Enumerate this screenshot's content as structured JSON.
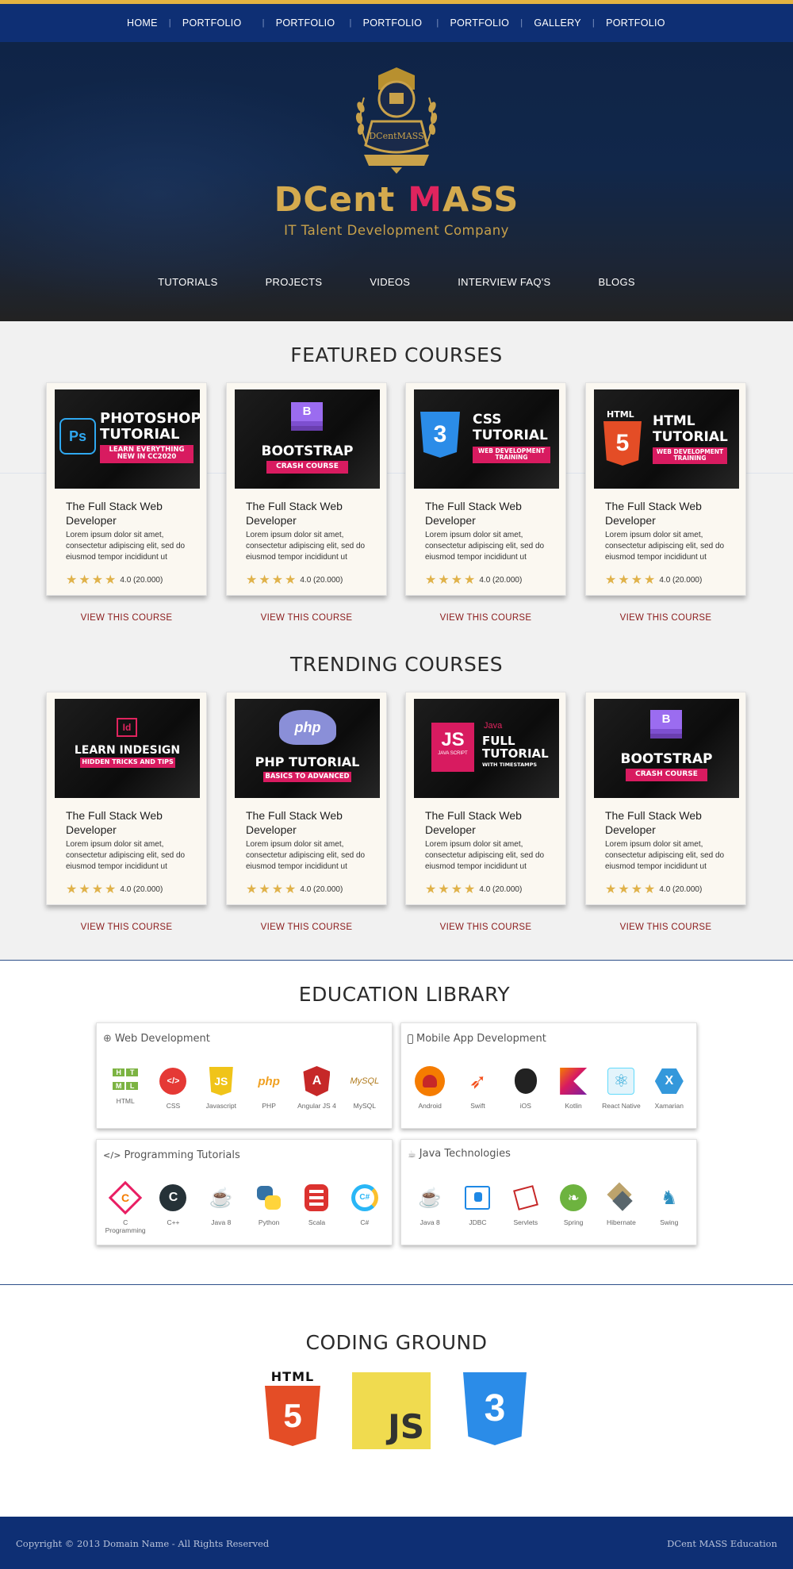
{
  "top_nav": {
    "items": [
      "HOME",
      "PORTFOLIO",
      "PORTFOLIO",
      "PORTFOLIO",
      "PORTFOLIO",
      "GALLERY",
      "PORTFOLIO"
    ]
  },
  "hero": {
    "emblem_text": "DCentMASS",
    "brand_main": "DCent ",
    "brand_accent": "M",
    "brand_rest": "ASS",
    "tagline": "IT Talent Development Company",
    "nav": [
      "TUTORIALS",
      "PROJECTS",
      "VIDEOS",
      "INTERVIEW FAQ'S",
      "BLOGS"
    ]
  },
  "featured": {
    "title": "FEATURED COURSES",
    "cards": [
      {
        "thumb": {
          "line1": "PHOTOSHOP",
          "line2": "TUTORIAL",
          "badge": "LEARN EVERYTHING NEW IN CC2020",
          "icon": "Ps"
        },
        "title": "The Full Stack Web Developer",
        "desc": "Lorem ipsum dolor sit amet, consectetur adipiscing elit, sed do eiusmod tempor incididunt ut",
        "rating": "4.0 (20.000)",
        "stars": 4,
        "link": "VIEW THIS COURSE"
      },
      {
        "thumb": {
          "line1": "BOOTSTRAP",
          "badge": "CRASH COURSE",
          "icon": "B"
        },
        "title": "The Full Stack Web Developer",
        "desc": "Lorem ipsum dolor sit amet, consectetur adipiscing elit, sed do eiusmod tempor incididunt ut",
        "rating": "4.0 (20.000)",
        "stars": 4,
        "link": "VIEW THIS COURSE"
      },
      {
        "thumb": {
          "line1": "CSS",
          "line2": "TUTORIAL",
          "badge": "WEB DEVELOPMENT TRAINING",
          "icon": "3"
        },
        "title": "The Full Stack Web Developer",
        "desc": "Lorem ipsum dolor sit amet, consectetur adipiscing elit, sed do eiusmod tempor incididunt ut",
        "rating": "4.0 (20.000)",
        "stars": 4,
        "link": "VIEW THIS COURSE"
      },
      {
        "thumb": {
          "line1": "HTML",
          "line2": "TUTORIAL",
          "badge": "WEB DEVELOPMENT TRAINING",
          "icon": "5",
          "iconlabel": "HTML"
        },
        "title": "The Full Stack Web Developer",
        "desc": "Lorem ipsum dolor sit amet, consectetur adipiscing elit, sed do eiusmod tempor incididunt ut",
        "rating": "4.0 (20.000)",
        "stars": 4,
        "link": "VIEW THIS COURSE"
      }
    ]
  },
  "trending": {
    "title": "TRENDING COURSES",
    "cards": [
      {
        "thumb": {
          "line1": "LEARN INDESIGN",
          "badge": "HIDDEN TRICKS AND TIPS",
          "icon": "Id"
        },
        "title": "The Full Stack Web Developer",
        "desc": "Lorem ipsum dolor sit amet, consectetur adipiscing elit, sed do eiusmod tempor incididunt ut",
        "rating": "4.0 (20.000)",
        "stars": 4,
        "link": "VIEW THIS COURSE"
      },
      {
        "thumb": {
          "line1": "PHP TUTORIAL",
          "badge": "BASICS TO ADVANCED",
          "icon": "php"
        },
        "title": "The Full Stack Web Developer",
        "desc": "Lorem ipsum dolor sit amet, consectetur adipiscing elit, sed do eiusmod tempor incididunt ut",
        "rating": "4.0 (20.000)",
        "stars": 4,
        "link": "VIEW THIS COURSE"
      },
      {
        "thumb": {
          "line1": "FULL",
          "line2": "TUTORIAL",
          "line3": "WITH TIMESTAMPS",
          "icon": "JS",
          "iconsub": "JAVA SCRIPT",
          "java": "Java"
        },
        "title": "The Full Stack Web Developer",
        "desc": "Lorem ipsum dolor sit amet, consectetur adipiscing elit, sed do eiusmod tempor incididunt ut",
        "rating": "4.0 (20.000)",
        "stars": 4,
        "link": "VIEW THIS COURSE"
      },
      {
        "thumb": {
          "line1": "BOOTSTRAP",
          "badge": "CRASH COURSE",
          "icon": "B"
        },
        "title": "The Full Stack Web Developer",
        "desc": "Lorem ipsum dolor sit amet, consectetur adipiscing elit, sed do eiusmod tempor incididunt ut",
        "rating": "4.0 (20.000)",
        "stars": 4,
        "link": "VIEW THIS COURSE"
      }
    ]
  },
  "library": {
    "title": "EDUCATION LIBRARY",
    "groups": [
      {
        "title": "Web Development",
        "icon": "globe-icon",
        "items": [
          {
            "label": "HTML",
            "icon": "html-icon"
          },
          {
            "label": "CSS",
            "icon": "css-icon"
          },
          {
            "label": "Javascript",
            "icon": "javascript-icon"
          },
          {
            "label": "PHP",
            "icon": "php-icon"
          },
          {
            "label": "Angular JS 4",
            "icon": "angular-icon"
          },
          {
            "label": "MySQL",
            "icon": "mysql-icon"
          }
        ]
      },
      {
        "title": "Mobile App Development",
        "icon": "mobile-icon",
        "items": [
          {
            "label": "Android",
            "icon": "android-icon"
          },
          {
            "label": "Swift",
            "icon": "swift-icon"
          },
          {
            "label": "iOS",
            "icon": "apple-icon"
          },
          {
            "label": "Kotlin",
            "icon": "kotlin-icon"
          },
          {
            "label": "React Native",
            "icon": "react-icon"
          },
          {
            "label": "Xamarian",
            "icon": "xamarin-icon"
          }
        ]
      },
      {
        "title": "Programming Tutorials",
        "icon": "code-icon",
        "items": [
          {
            "label": "C Programming",
            "icon": "c-icon"
          },
          {
            "label": "C++",
            "icon": "cpp-icon"
          },
          {
            "label": "Java 8",
            "icon": "java-icon"
          },
          {
            "label": "Python",
            "icon": "python-icon"
          },
          {
            "label": "Scala",
            "icon": "scala-icon"
          },
          {
            "label": "C#",
            "icon": "csharp-icon"
          }
        ]
      },
      {
        "title": "Java Technologies",
        "icon": "java-cup-icon",
        "items": [
          {
            "label": "Java 8",
            "icon": "java-icon"
          },
          {
            "label": "JDBC",
            "icon": "jdbc-icon"
          },
          {
            "label": "Servlets",
            "icon": "servlets-icon"
          },
          {
            "label": "Spring",
            "icon": "spring-icon"
          },
          {
            "label": "Hibernate",
            "icon": "hibernate-icon"
          },
          {
            "label": "Swing",
            "icon": "swing-icon"
          }
        ]
      }
    ]
  },
  "coding": {
    "title": "CODING GROUND",
    "html_label": "HTML",
    "html_num": "5",
    "js_label": "JS",
    "css_num": "3"
  },
  "footer": {
    "left": "Copyright © 2013 Domain Name - All Rights Reserved",
    "right": "DCent MASS Education"
  },
  "colors": {
    "navy": "#0e2f74",
    "gold": "#d4aa4e",
    "pink": "#d81b60",
    "accent_link": "#8b1a1a"
  }
}
